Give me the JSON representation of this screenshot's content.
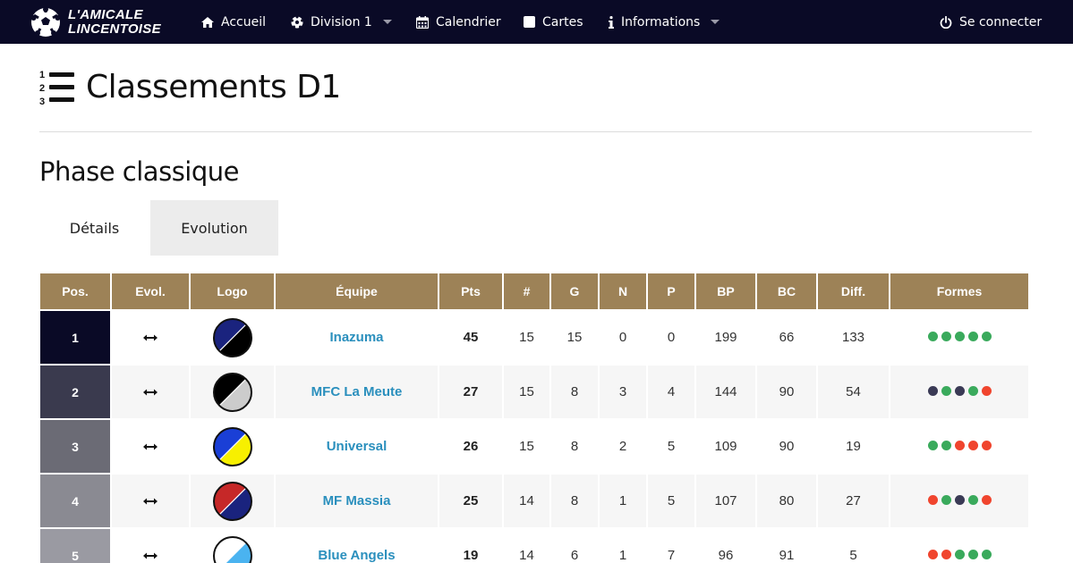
{
  "nav": {
    "brand_line1": "L'AMICALE",
    "brand_line2": "LINCENTOISE",
    "items": [
      {
        "label": "Accueil",
        "icon": "home-icon"
      },
      {
        "label": "Division 1",
        "icon": "soccer-ball-icon",
        "dropdown": true
      },
      {
        "label": "Calendrier",
        "icon": "calendar-icon"
      },
      {
        "label": "Cartes",
        "icon": "card-icon"
      },
      {
        "label": "Informations",
        "icon": "info-icon",
        "dropdown": true
      }
    ],
    "login": "Se connecter"
  },
  "page": {
    "title": "Classements D1",
    "section": "Phase classique",
    "tabs": [
      "Détails",
      "Evolution"
    ]
  },
  "table": {
    "headers": [
      "Pos.",
      "Evol.",
      "Logo",
      "Équipe",
      "Pts",
      "#",
      "G",
      "N",
      "P",
      "BP",
      "BC",
      "Diff.",
      "Formes"
    ],
    "rows": [
      {
        "pos": "1",
        "team": "Inazuma",
        "pts": "45",
        "played": "15",
        "g": "15",
        "n": "0",
        "p": "0",
        "bp": "199",
        "bc": "66",
        "diff": "133",
        "pos_color": "#0a0a26",
        "logo_colors": [
          "#1a237e",
          "#000000"
        ],
        "form": [
          "win",
          "win",
          "win",
          "win",
          "win"
        ]
      },
      {
        "pos": "2",
        "team": "MFC La Meute",
        "pts": "27",
        "played": "15",
        "g": "8",
        "n": "3",
        "p": "4",
        "bp": "144",
        "bc": "90",
        "diff": "54",
        "pos_color": "#3a3a4e",
        "logo_colors": [
          "#000000",
          "#cccccc"
        ],
        "form": [
          "draw",
          "win",
          "draw",
          "win",
          "loss"
        ]
      },
      {
        "pos": "3",
        "team": "Universal",
        "pts": "26",
        "played": "15",
        "g": "8",
        "n": "2",
        "p": "5",
        "bp": "109",
        "bc": "90",
        "diff": "19",
        "pos_color": "#6b6b75",
        "logo_colors": [
          "#1a3fd6",
          "#f7f000"
        ],
        "form": [
          "win",
          "win",
          "loss",
          "loss",
          "loss"
        ]
      },
      {
        "pos": "4",
        "team": "MF Massia",
        "pts": "25",
        "played": "14",
        "g": "8",
        "n": "1",
        "p": "5",
        "bp": "107",
        "bc": "80",
        "diff": "27",
        "pos_color": "#8a8a92",
        "logo_colors": [
          "#c62828",
          "#1a237e"
        ],
        "form": [
          "loss",
          "win",
          "draw",
          "win",
          "loss"
        ]
      },
      {
        "pos": "5",
        "team": "Blue Angels",
        "pts": "19",
        "played": "14",
        "g": "6",
        "n": "1",
        "p": "7",
        "bp": "96",
        "bc": "91",
        "diff": "5",
        "pos_color": "#9a9aa2",
        "logo_colors": [
          "#ffffff",
          "#4ab3f0"
        ],
        "form": [
          "loss",
          "loss",
          "win",
          "win",
          "win"
        ]
      }
    ]
  },
  "form_colors": {
    "win": "#3aaa5c",
    "draw": "#3a3a55",
    "loss": "#f0452e"
  },
  "colors": {
    "navbar": "#0a0a26",
    "header": "#9d8257",
    "link": "#2a8fbd"
  }
}
